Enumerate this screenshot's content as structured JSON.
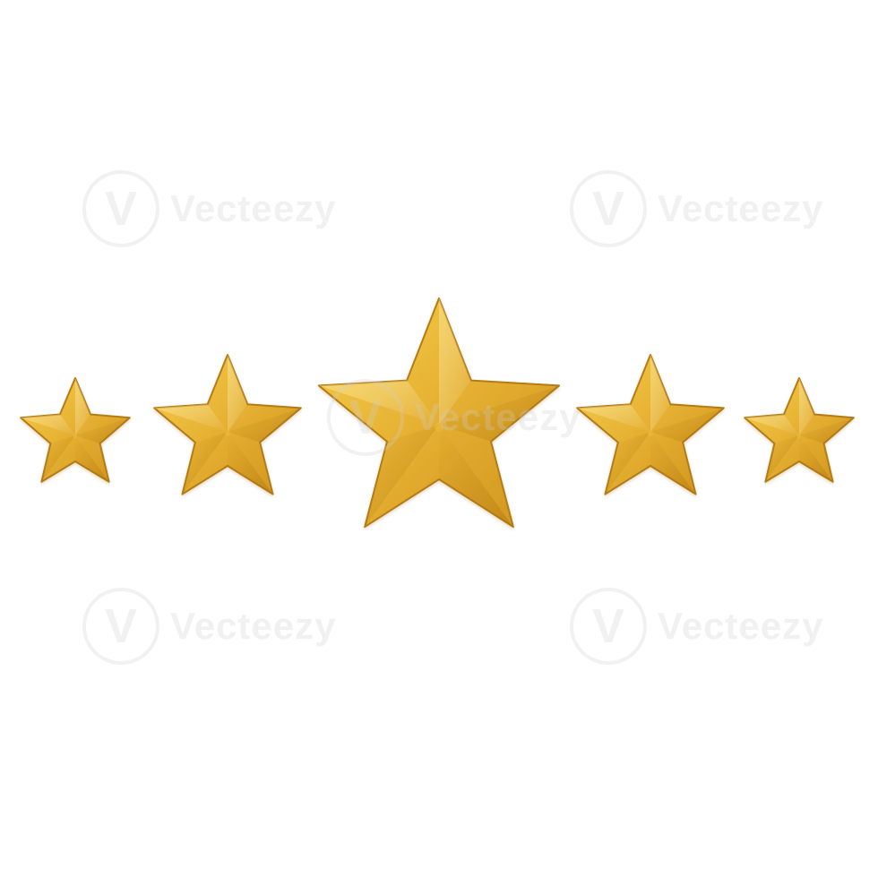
{
  "rating": {
    "filled_stars": 5,
    "total_stars": 5
  },
  "colors": {
    "background": "#ffffff",
    "star_light": "#f4c542",
    "star_mid": "#e3ab2f",
    "star_dark": "#c98f1f",
    "star_edge": "#b57b13"
  },
  "icons": [
    "star-icon",
    "star-icon",
    "star-icon",
    "star-icon",
    "star-icon"
  ],
  "watermark": {
    "text": "Vecteezy",
    "mark": "V"
  }
}
